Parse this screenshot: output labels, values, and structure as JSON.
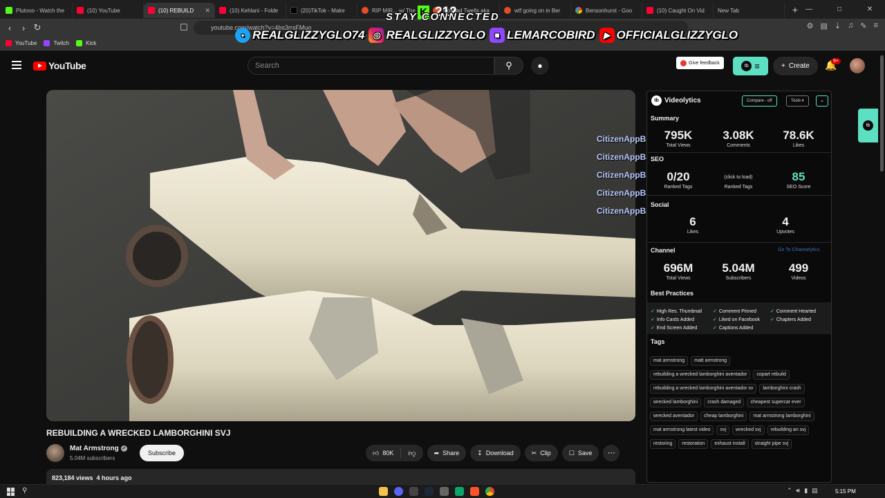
{
  "browser": {
    "tabs": [
      {
        "label": "Plutooo - Watch the",
        "fav": "kick"
      },
      {
        "label": "(10) YouTube",
        "fav": "yt"
      },
      {
        "label": "(10) REBUILD",
        "fav": "yt",
        "active": true
      },
      {
        "label": "(10) Kehlani - Folde",
        "fav": "yt"
      },
      {
        "label": "(20)TikTok - Make",
        "fav": "tt"
      },
      {
        "label": "RIP MIR... w/ The",
        "fav": "red"
      },
      {
        "label": "Roshad Twells aka",
        "fav": "red"
      },
      {
        "label": "wtf going on in Ber",
        "fav": "red"
      },
      {
        "label": "Bensonhurst - Goo",
        "fav": "g"
      },
      {
        "label": "(10) Caught On Vid",
        "fav": "yt"
      },
      {
        "label": "New Tab",
        "fav": ""
      }
    ],
    "url": "youtube.com/watch?v=4bs3rrsFMuo",
    "bookmarks": [
      {
        "label": "YouTube",
        "fav": "yt"
      },
      {
        "label": "Twitch",
        "fav": "tw"
      },
      {
        "label": "Kick",
        "fav": "kick"
      }
    ]
  },
  "stream_overlay": {
    "stay_connected": "STAY CONNECTED",
    "socials": [
      {
        "icon": "twitter-icon",
        "label": "REALGLIZZYGLO74"
      },
      {
        "icon": "instagram-icon",
        "label": "REALGLIZZYGLO"
      },
      {
        "icon": "twitch-icon",
        "label": "LEMARCOBIRD"
      },
      {
        "icon": "youtube-icon",
        "label": "OFFICIALGLIZZYGLO"
      }
    ],
    "kick_count": "212",
    "chat": [
      "CitizenAppBanginn:",
      "CitizenAppBanginn:",
      "CitizenAppBanginn:",
      "CitizenAppBanginn:",
      "CitizenAppBanginn:"
    ]
  },
  "youtube": {
    "logo": "YouTube",
    "search_placeholder": "Search",
    "feedback": "Give feedback",
    "create": "Create",
    "notif_badge": "9+",
    "video": {
      "title": "REBUILDING A WRECKED LAMBORGHINI SVJ",
      "channel": "Mat Armstrong",
      "subscribers": "5.04M subscribers",
      "subscribe": "Subscribe",
      "likes": "80K",
      "share": "Share",
      "download": "Download",
      "clip": "Clip",
      "save": "Save",
      "views_line": "823,184 views  4 hours ago"
    }
  },
  "videolytics": {
    "name": "Videolytics",
    "compare": "Compare - off",
    "tools": "Tools",
    "summary_label": "Summary",
    "summary": [
      {
        "value": "795K",
        "label": "Total Views"
      },
      {
        "value": "3.08K",
        "label": "Comments"
      },
      {
        "value": "78.6K",
        "label": "Likes"
      }
    ],
    "seo_label": "SEO",
    "seo": [
      {
        "value": "0/20",
        "label": "Ranked Tags"
      },
      {
        "value": "(click to load)",
        "label": "Ranked Tags"
      },
      {
        "value": "85",
        "label": "SEO Score"
      }
    ],
    "social_label": "Social",
    "social": [
      {
        "value": "6",
        "label": "Likes"
      },
      {
        "value": "4",
        "label": "Upvotes"
      }
    ],
    "channel_label": "Channel",
    "channel_link": "Go To Channelytics",
    "channel": [
      {
        "value": "696M",
        "label": "Total Views"
      },
      {
        "value": "5.04M",
        "label": "Subscribers"
      },
      {
        "value": "499",
        "label": "Videos"
      }
    ],
    "best_practices_label": "Best Practices",
    "best_practices": [
      "High Res. Thumbnail",
      "Comment Pinned",
      "Comment Hearted",
      "Info Cards Added",
      "Liked on Facebook",
      "Chapters Added",
      "End Screen Added",
      "Captions Added"
    ],
    "tags_label": "Tags",
    "tags": [
      "mat armstrong",
      "matt armstrong",
      "rebuilding a wrecked lamborghini aventador",
      "copart rebuild",
      "rebuilding a wrecked lamborghini aventador sv",
      "lamborghini crash",
      "wrecked lamborghini",
      "crash damaged",
      "cheapest supercar ever",
      "wrecked aventador",
      "cheap lamborghini",
      "mat armstrong lamborghini",
      "mat armstrong latest video",
      "svj",
      "wrecked svj",
      "rebuilding an svj",
      "restoring",
      "restoration",
      "exhaust install",
      "straight pipe svj"
    ]
  },
  "taskbar": {
    "time": "5:15 PM"
  }
}
